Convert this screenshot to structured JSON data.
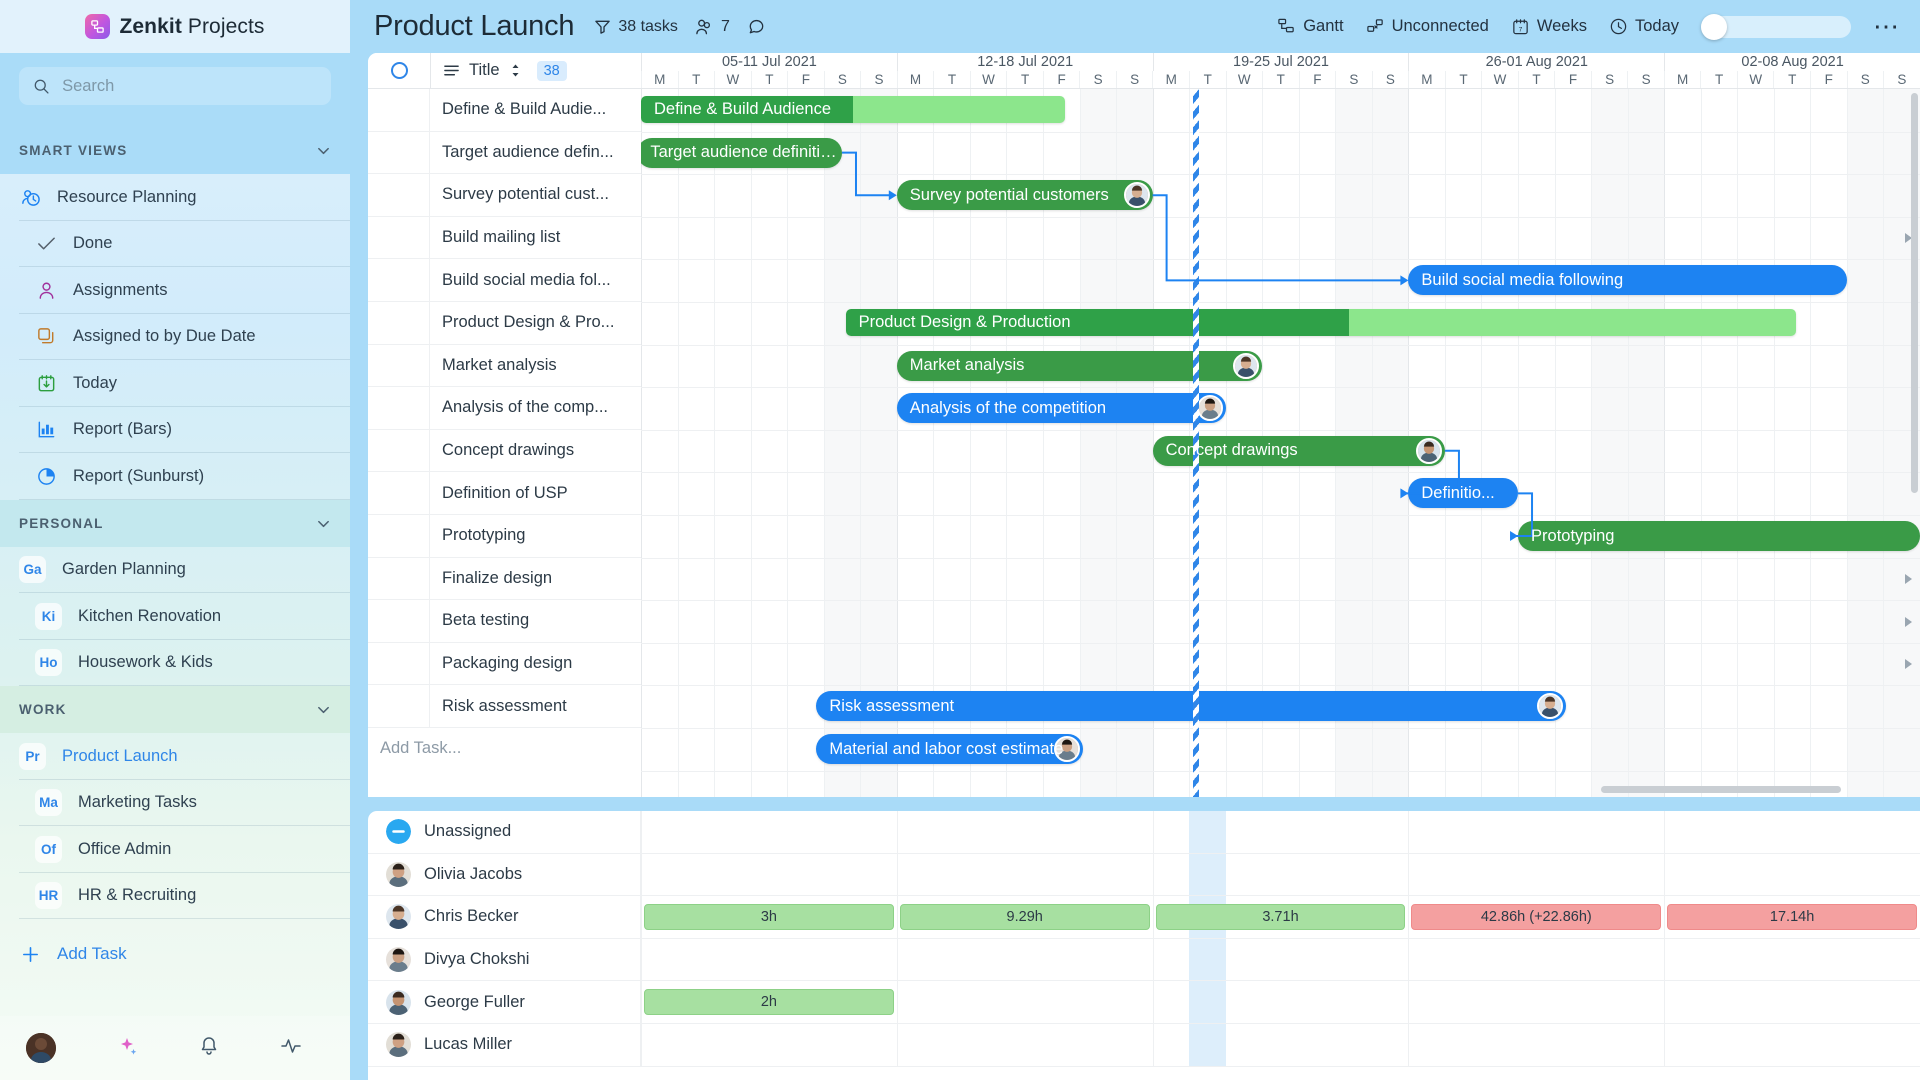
{
  "brand": {
    "name_bold": "Zenkit",
    "name_light": "Projects",
    "logo_icon": "zenkit-logo-icon"
  },
  "search": {
    "placeholder": "Search",
    "value": "",
    "icon": "search-icon"
  },
  "sidebar": {
    "sections": [
      {
        "id": "smart-views",
        "label": "SMART VIEWS",
        "items": [
          {
            "label": "Resource Planning",
            "icon": "resource-planning-icon",
            "active": false
          },
          {
            "label": "Done",
            "icon": "check-icon",
            "active": false
          },
          {
            "label": "Assignments",
            "icon": "person-icon",
            "active": false
          },
          {
            "label": "Assigned to by Due Date",
            "icon": "stack-icon",
            "active": false
          },
          {
            "label": "Today",
            "icon": "calendar-today-icon",
            "active": false
          },
          {
            "label": "Report (Bars)",
            "icon": "bar-chart-icon",
            "active": false
          },
          {
            "label": "Report (Sunburst)",
            "icon": "pie-chart-icon",
            "active": false
          }
        ]
      },
      {
        "id": "personal",
        "label": "PERSONAL",
        "items": [
          {
            "label": "Garden Planning",
            "badge": "Ga",
            "active": false
          },
          {
            "label": "Kitchen Renovation",
            "badge": "Ki",
            "active": false
          },
          {
            "label": "Housework & Kids",
            "badge": "Ho",
            "active": false
          }
        ]
      },
      {
        "id": "work",
        "label": "WORK",
        "items": [
          {
            "label": "Product Launch",
            "badge": "Pr",
            "active": true
          },
          {
            "label": "Marketing Tasks",
            "badge": "Ma",
            "active": false
          },
          {
            "label": "Office Admin",
            "badge": "Of",
            "active": false
          },
          {
            "label": "HR & Recruiting",
            "badge": "HR",
            "active": false
          }
        ]
      }
    ],
    "add_task": {
      "label": "Add Task",
      "icon": "plus-icon"
    },
    "footer_icons": [
      "user-avatar",
      "sparkle-icon",
      "bell-icon",
      "activity-icon"
    ]
  },
  "topbar": {
    "title": "Product Launch",
    "task_count": "38 tasks",
    "member_count": "7",
    "filter_icon": "filter-icon",
    "members_icon": "members-icon",
    "comment_icon": "comment-icon",
    "buttons": [
      {
        "label": "Gantt",
        "icon": "gantt-icon"
      },
      {
        "label": "Unconnected",
        "icon": "unconnected-icon"
      },
      {
        "label": "Weeks",
        "icon": "calendar-icon"
      },
      {
        "label": "Today",
        "icon": "clock-icon"
      }
    ],
    "toggle_on": false,
    "overflow_icon": "more-icon"
  },
  "gantt": {
    "header": {
      "title_col": "Title",
      "count": "38",
      "sort_icon": "sort-icon",
      "list-icon": "list-icon",
      "select_all_icon": "circle-icon"
    },
    "add_task_placeholder": "Add Task...",
    "weeks": [
      "05-11 Jul 2021",
      "12-18 Jul 2021",
      "19-25 Jul 2021",
      "26-01 Aug 2021",
      "02-08 Aug 2021"
    ],
    "days": [
      "M",
      "T",
      "W",
      "T",
      "F",
      "S",
      "S"
    ],
    "rows": [
      {
        "title": "Define & Build Audie...",
        "bar": {
          "label": "Define & Build Audience",
          "type": "group",
          "color": "#2fa148",
          "progress_color": "#8ce68c",
          "start": 0,
          "span": 11.6,
          "progress": 0.5,
          "avatar": false,
          "expander": false
        }
      },
      {
        "title": "Target audience defin...",
        "bar": {
          "label": "Target audience definition and a...",
          "type": "task",
          "color": "#3a9b47",
          "start": -0.1,
          "span": 5.6,
          "avatar": false,
          "expander": false
        }
      },
      {
        "title": "Survey potential cust...",
        "bar": {
          "label": "Survey potential customers",
          "type": "task",
          "color": "#3a9b47",
          "start": 7.0,
          "span": 7.0,
          "avatar": true,
          "expander": false
        }
      },
      {
        "title": "Build mailing list",
        "bar": null,
        "expander": true
      },
      {
        "title": "Build social media fol...",
        "bar": {
          "label": "Build social media following",
          "type": "task",
          "color": "#1d83f2",
          "start": 21.0,
          "span": 12.0,
          "avatar": false,
          "expander": false
        }
      },
      {
        "title": "Product Design & Pro...",
        "bar": {
          "label": "Product Design & Production",
          "type": "group",
          "color": "#2fa148",
          "progress_color": "#8ce68c",
          "start": 5.6,
          "span": 26.0,
          "progress": 0.53,
          "avatar": false,
          "expander": false
        }
      },
      {
        "title": "Market analysis",
        "bar": {
          "label": "Market analysis",
          "type": "task",
          "color": "#3a9b47",
          "start": 7.0,
          "span": 10.0,
          "avatar": true,
          "expander": false
        }
      },
      {
        "title": "Analysis of the comp...",
        "bar": {
          "label": "Analysis of the competition",
          "type": "task",
          "color": "#1d83f2",
          "start": 7.0,
          "span": 9.0,
          "avatar": true,
          "expander": false
        }
      },
      {
        "title": "Concept drawings",
        "bar": {
          "label": "Concept drawings",
          "type": "task",
          "color": "#3a9b47",
          "start": 14.0,
          "span": 8.0,
          "avatar": true,
          "expander": false
        }
      },
      {
        "title": "Definition of USP",
        "bar": {
          "label": "Definitio...",
          "type": "task",
          "color": "#1d83f2",
          "start": 21.0,
          "span": 3.0,
          "avatar": false,
          "expander": false
        }
      },
      {
        "title": "Prototyping",
        "bar": {
          "label": "Prototyping",
          "type": "task",
          "color": "#3a9b47",
          "start": 24.0,
          "span": 11.0,
          "avatar": false,
          "expander": false
        }
      },
      {
        "title": "Finalize design",
        "bar": null,
        "expander": true
      },
      {
        "title": "Beta testing",
        "bar": null,
        "expander": true
      },
      {
        "title": "Packaging design",
        "bar": null,
        "expander": true
      },
      {
        "title": "Risk assessment",
        "bar": {
          "label": "Risk assessment",
          "type": "task",
          "color": "#1d83f2",
          "start": 4.8,
          "span": 20.5,
          "avatar": true,
          "expander": false
        }
      },
      {
        "title": "Material and labor cost estimate",
        "hidden_title": true,
        "bar": {
          "label": "Material and labor cost estimate",
          "type": "task",
          "color": "#1d83f2",
          "start": 4.8,
          "span": 7.3,
          "avatar": true,
          "expander": false
        }
      }
    ],
    "today_position_days": 15.1
  },
  "resources": {
    "rows": [
      {
        "name": "Unassigned",
        "avatar": "minus-badge",
        "bars": []
      },
      {
        "name": "Olivia Jacobs",
        "avatar": "photo",
        "bars": []
      },
      {
        "name": "Chris Becker",
        "avatar": "photo",
        "bars": [
          {
            "week": 0,
            "label": "3h",
            "status": "ok"
          },
          {
            "week": 1,
            "label": "9.29h",
            "status": "ok"
          },
          {
            "week": 2,
            "label": "3.71h",
            "status": "ok"
          },
          {
            "week": 3,
            "label": "42.86h (+22.86h)",
            "status": "over"
          },
          {
            "week": 4,
            "label": "17.14h",
            "status": "over"
          }
        ]
      },
      {
        "name": "Divya Chokshi",
        "avatar": "photo",
        "bars": []
      },
      {
        "name": "George Fuller",
        "avatar": "photo",
        "bars": [
          {
            "week": 0,
            "label": "2h",
            "status": "ok"
          }
        ]
      },
      {
        "name": "Lucas Miller",
        "avatar": "photo",
        "bars": []
      }
    ]
  },
  "colors": {
    "accent_blue": "#1d83f2",
    "green_bar": "#3a9b47",
    "group_green": "#2fa148",
    "progress_green": "#8ce68c",
    "workload_ok": "#a7e0a1",
    "workload_over": "#f4a0a0",
    "sidebar_top": "#aadcf8",
    "topbar": "#a9dbf8"
  }
}
